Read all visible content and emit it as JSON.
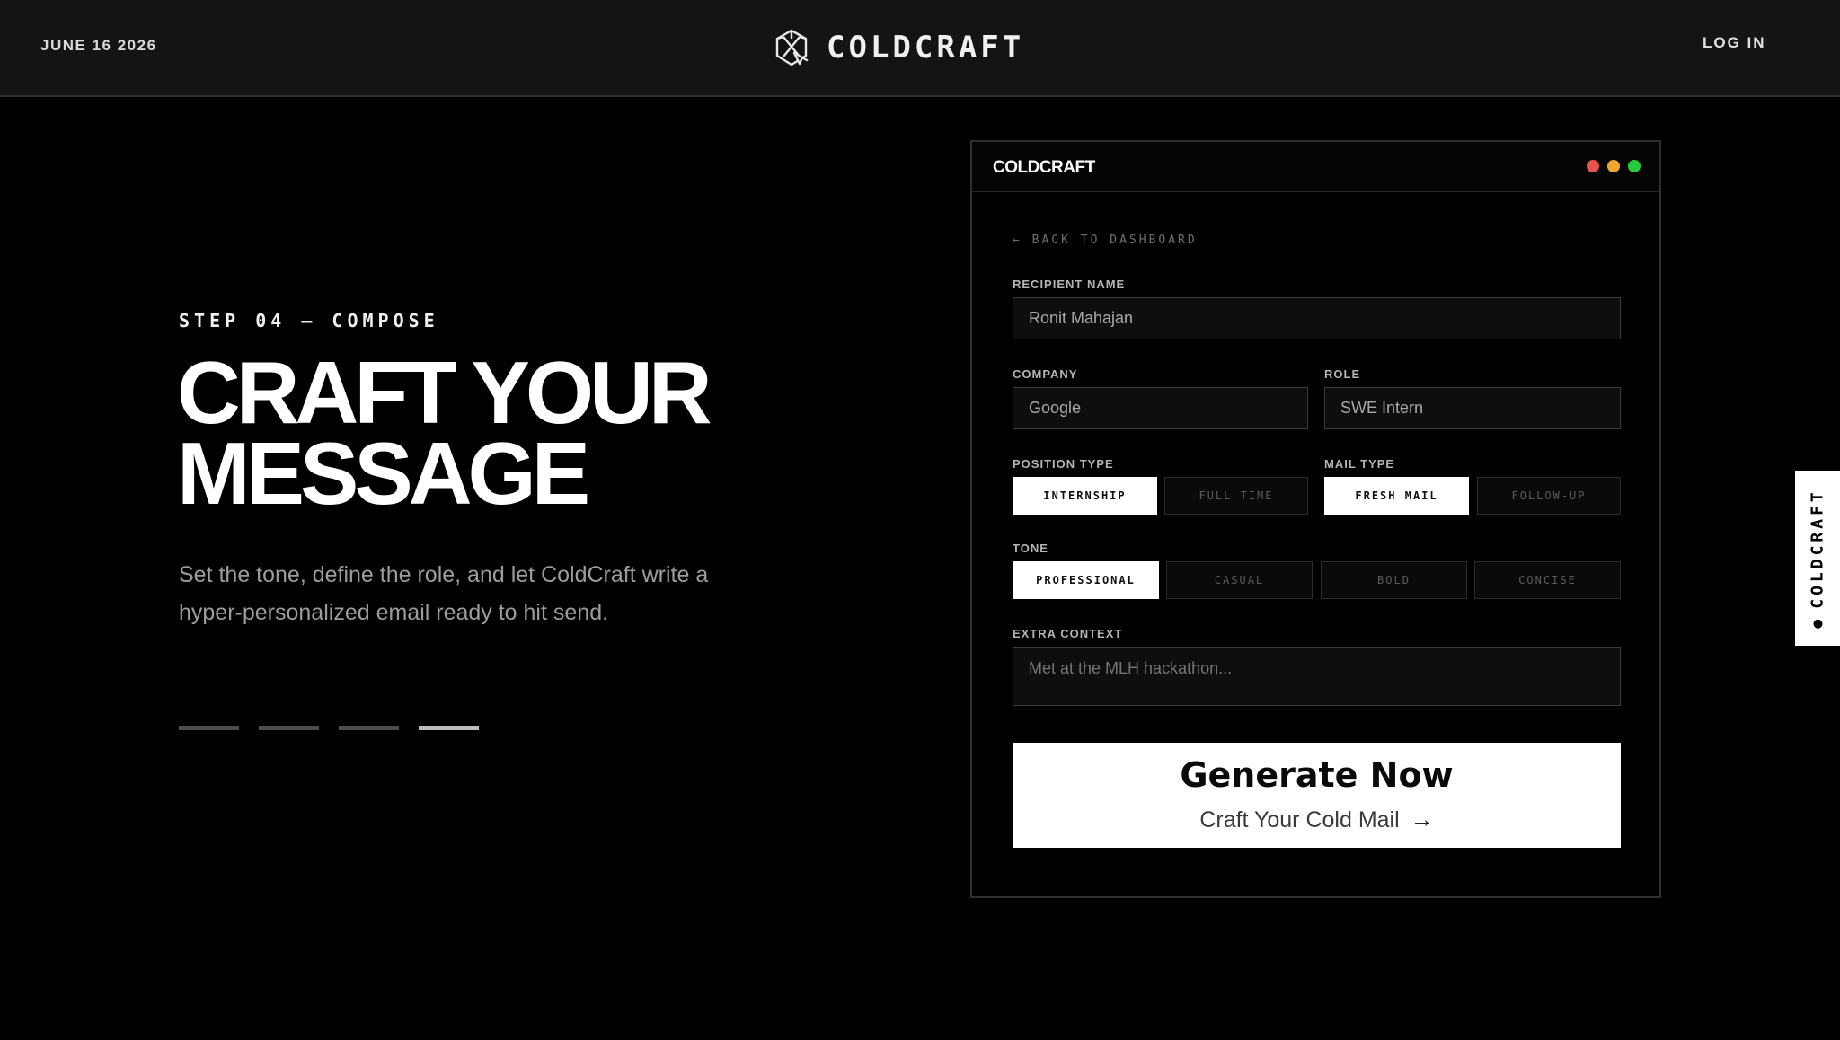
{
  "header": {
    "date": "JUNE 16 2026",
    "brand": "COLDCRAFT",
    "brand_icon": "crystal-icon",
    "login": "LOG IN"
  },
  "hero": {
    "step": "STEP 04 — COMPOSE",
    "headline_line1": "CRAFT YOUR",
    "headline_line2": "MESSAGE",
    "description": "Set the tone, define the role, and let ColdCraft write a hyper-personalized email ready to hit send.",
    "progress_total": 4,
    "progress_active": 4
  },
  "card": {
    "title": "COLDCRAFT",
    "window_dots": [
      "#e5534b",
      "#f0a732",
      "#28c940"
    ],
    "back_link": "← BACK TO DASHBOARD",
    "recipient": {
      "label": "RECIPIENT NAME",
      "value": "Ronit Mahajan"
    },
    "company": {
      "label": "COMPANY",
      "value": "Google"
    },
    "role": {
      "label": "ROLE",
      "value": "SWE Intern"
    },
    "position_type": {
      "label": "POSITION TYPE",
      "options": [
        "INTERNSHIP",
        "FULL TIME"
      ],
      "selected": "INTERNSHIP"
    },
    "mail_type": {
      "label": "MAIL TYPE",
      "options": [
        "FRESH MAIL",
        "FOLLOW-UP"
      ],
      "selected": "FRESH MAIL"
    },
    "tone": {
      "label": "TONE",
      "options": [
        "PROFESSIONAL",
        "CASUAL",
        "BOLD",
        "CONCISE"
      ],
      "selected": "PROFESSIONAL"
    },
    "extra_context": {
      "label": "EXTRA CONTEXT",
      "placeholder": "Met at the MLH hackathon..."
    },
    "generate": {
      "title": "Generate Now",
      "subtitle": "Craft Your Cold Mail",
      "arrow": "arrow-right-icon"
    }
  },
  "side_tab": {
    "label": "COLDCRAFT"
  }
}
